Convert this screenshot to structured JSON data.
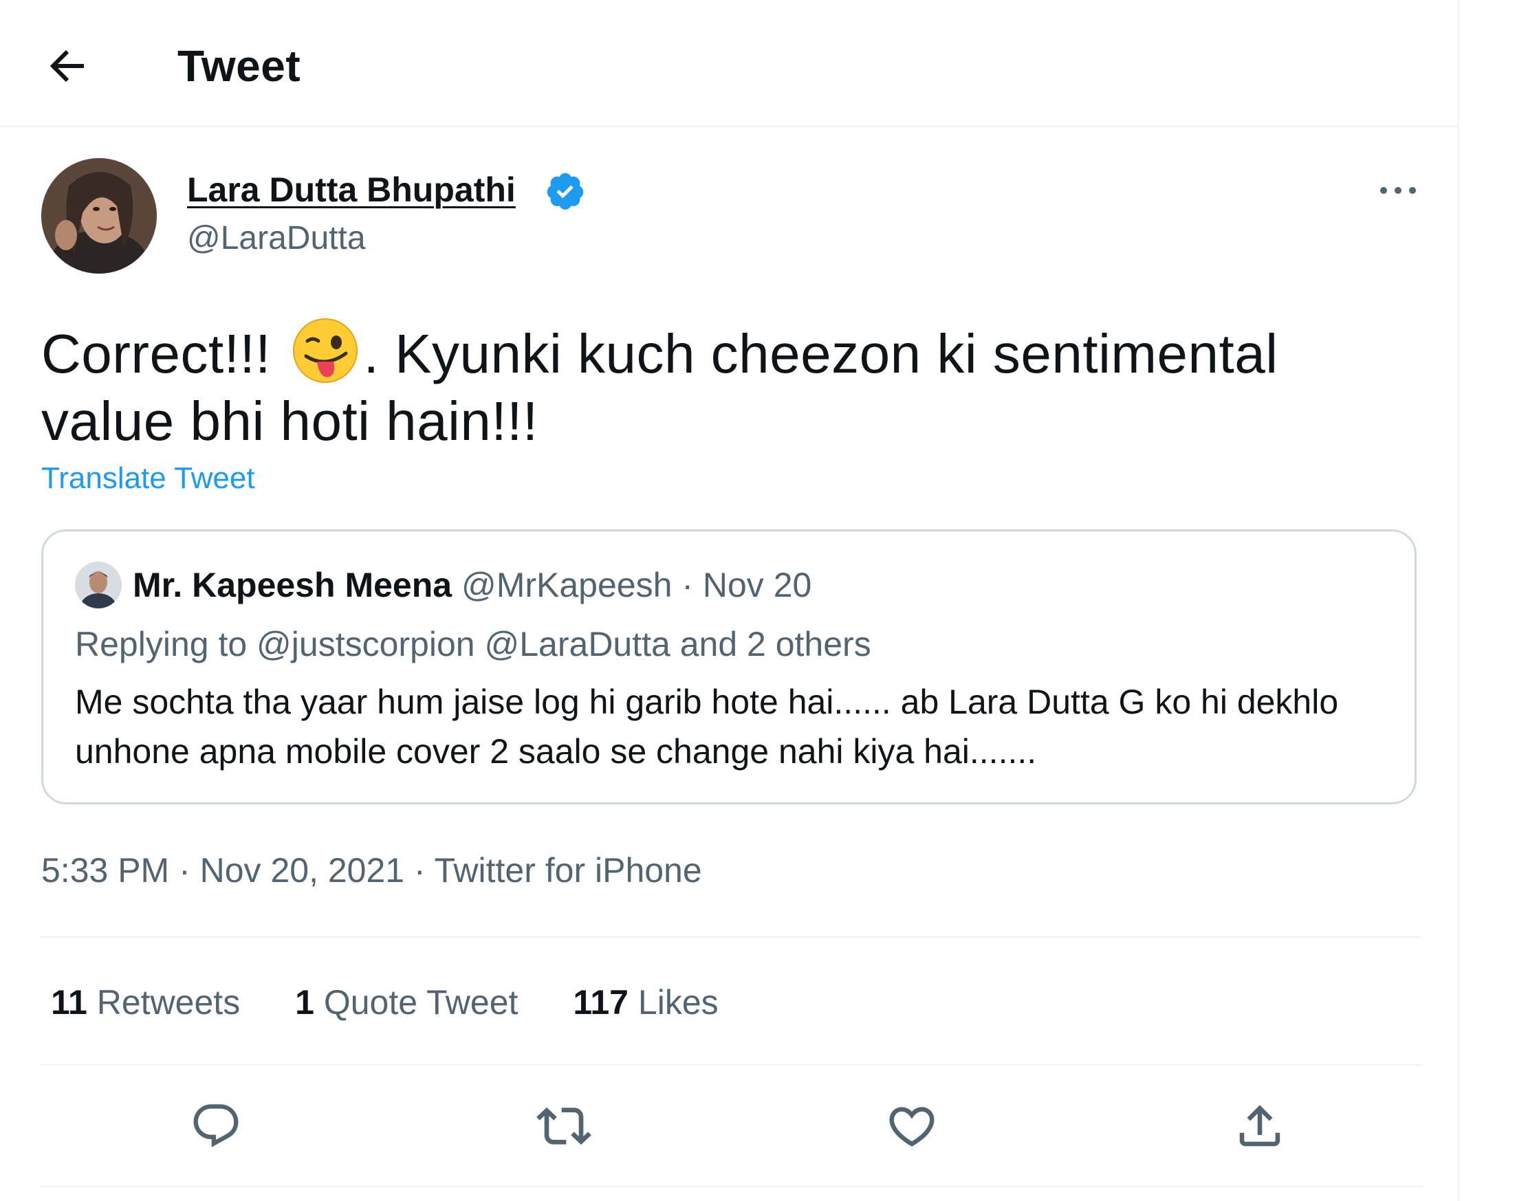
{
  "header": {
    "title": "Tweet",
    "back_icon": "arrow-left-icon"
  },
  "author": {
    "name": "Lara Dutta Bhupathi",
    "handle": "@LaraDutta",
    "verified_color": "#1d9bf0"
  },
  "tweet": {
    "text_before_emoji": "Correct!!! ",
    "emoji": "winking-face-with-tongue-emoji",
    "text_after_emoji": ". Kyunki kuch cheezon ki sentimental value bhi hoti hain!!!",
    "translate_label": "Translate Tweet"
  },
  "quote": {
    "name": "Mr. Kapeesh Meena",
    "handle": "@MrKapeesh",
    "separator": "·",
    "date": "Nov 20",
    "replying_to": "Replying to @justscorpion @LaraDutta and 2 others",
    "text": "Me sochta tha yaar hum jaise log hi garib hote hai...... ab Lara Dutta G ko hi dekhlo unhone apna mobile cover 2 saalo se change nahi kiya hai......."
  },
  "timestamp": "5:33 PM · Nov 20, 2021 · Twitter for iPhone",
  "stats": [
    {
      "count": "11",
      "label": "Retweets"
    },
    {
      "count": "1",
      "label": "Quote Tweet"
    },
    {
      "count": "117",
      "label": "Likes"
    }
  ],
  "actions": [
    "reply-icon",
    "retweet-icon",
    "like-icon",
    "share-icon"
  ],
  "colors": {
    "accent": "#1d9bf0",
    "secondary_text": "#536471",
    "border": "#cfd9de"
  }
}
